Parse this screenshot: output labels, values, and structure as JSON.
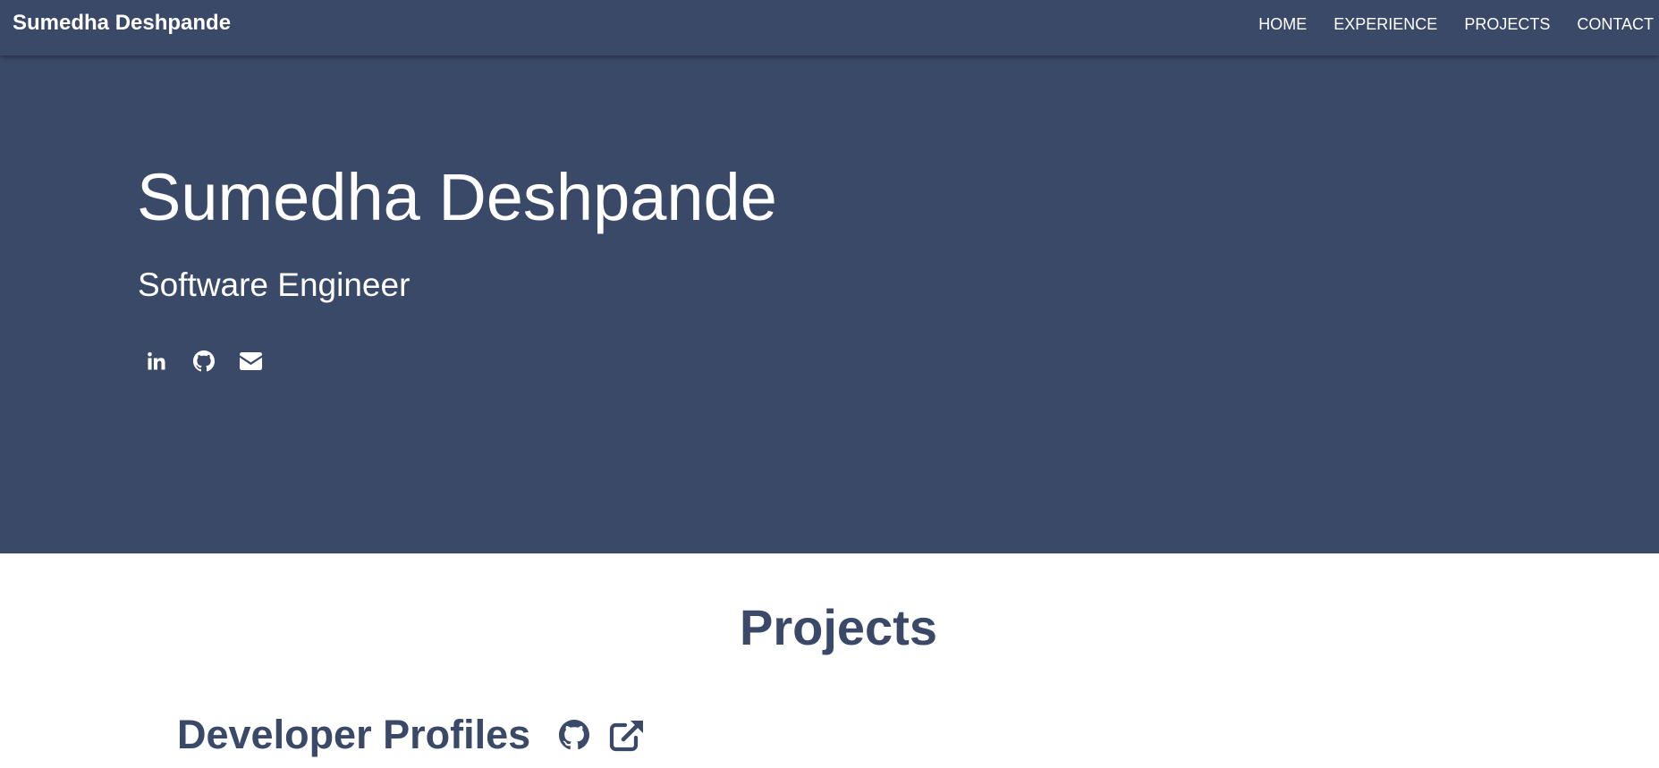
{
  "nav": {
    "brand": "Sumedha Deshpande",
    "links": [
      "HOME",
      "EXPERIENCE",
      "PROJECTS",
      "CONTACT"
    ]
  },
  "hero": {
    "name": "Sumedha Deshpande",
    "role": "Software Engineer",
    "social_icons": [
      "linkedin-icon",
      "github-icon",
      "envelope-icon"
    ]
  },
  "projects": {
    "heading": "Projects",
    "items": [
      {
        "title": "Developer Profiles",
        "icons": [
          "github-icon",
          "external-link-icon"
        ]
      }
    ]
  },
  "colors": {
    "primary": "#3a4968",
    "text_light": "#ffffff",
    "background": "#ffffff"
  }
}
